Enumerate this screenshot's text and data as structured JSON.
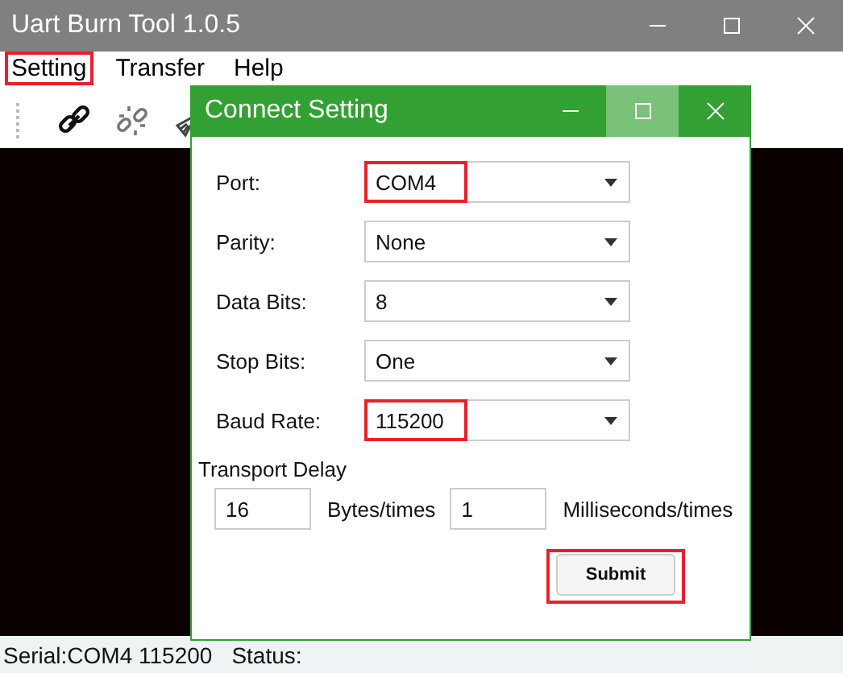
{
  "window": {
    "title": "Uart Burn Tool 1.0.5"
  },
  "menu": [
    {
      "label": "Setting",
      "highlighted": true
    },
    {
      "label": "Transfer",
      "highlighted": false
    },
    {
      "label": "Help",
      "highlighted": false
    }
  ],
  "toolbar": [
    {
      "kind": "link"
    },
    {
      "kind": "unlink"
    },
    {
      "kind": "broom"
    }
  ],
  "dialog": {
    "title": "Connect Setting",
    "title_buttons": [
      {
        "kind": "minimize",
        "hovered": false
      },
      {
        "kind": "maximize",
        "hovered": true
      },
      {
        "kind": "close",
        "hovered": false
      }
    ],
    "fields": [
      {
        "label": "Port:",
        "value": "COM4",
        "highlighted": true
      },
      {
        "label": "Parity:",
        "value": "None",
        "highlighted": false
      },
      {
        "label": "Data Bits:",
        "value": "8",
        "highlighted": false
      },
      {
        "label": "Stop Bits:",
        "value": "One",
        "highlighted": false
      },
      {
        "label": "Baud Rate:",
        "value": "115200",
        "highlighted": true
      }
    ],
    "delay": {
      "title": "Transport Delay",
      "bytes": "16",
      "bytes_unit": "Bytes/times",
      "interval": "1",
      "interval_unit": "Milliseconds/times"
    },
    "submit": {
      "label": "Submit",
      "highlighted": true
    }
  },
  "status_bar": {
    "serial": "Serial:COM4 115200",
    "status": "Status:"
  }
}
